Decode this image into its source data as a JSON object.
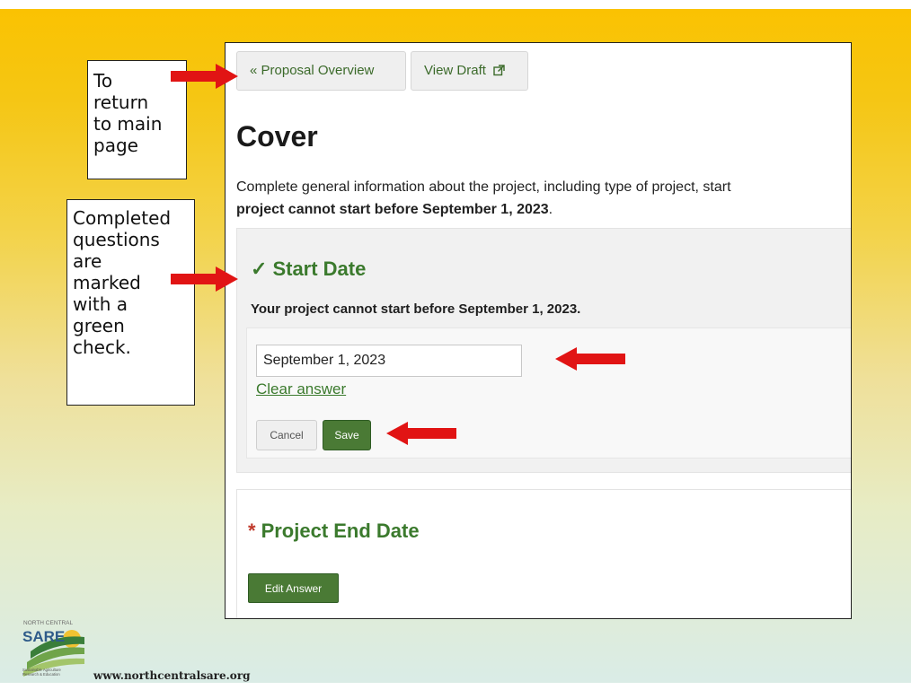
{
  "callouts": {
    "return": [
      "To",
      "return",
      "to main",
      "page"
    ],
    "check": [
      "Completed",
      "questions",
      "are",
      "marked",
      "with a",
      "green",
      "check."
    ]
  },
  "nav": {
    "proposal_overview": "« Proposal Overview",
    "view_draft": "View Draft"
  },
  "page": {
    "title": "Cover",
    "intro_line1": "Complete general information about the project, including type of project, start",
    "intro_line2_bold": "project cannot start before September 1, 2023",
    "intro_line2_end": "."
  },
  "start_date": {
    "check": "✓",
    "heading": "Start Date",
    "help": "Your project cannot start before September 1, 2023.",
    "value": "September 1, 2023",
    "clear_label": "Clear answer",
    "cancel_label": "Cancel",
    "save_label": "Save"
  },
  "end_date": {
    "required_marker": "*",
    "heading": "Project End Date",
    "edit_label": "Edit Answer"
  },
  "footer": {
    "logo_top": "NORTH CENTRAL",
    "logo_main": "SARE",
    "logo_sub1": "Sustainable Agriculture",
    "logo_sub2": "Research & Education",
    "url": "www.northcentralsare.org"
  },
  "colors": {
    "arrow": "#e11414",
    "green": "#3b7a2d",
    "button_green": "#4a7a35"
  }
}
